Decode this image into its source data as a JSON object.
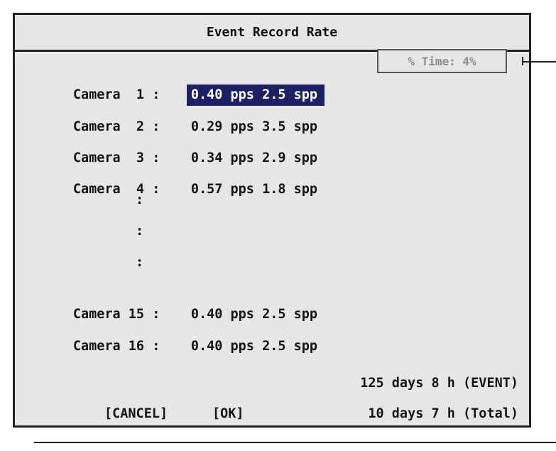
{
  "dialog": {
    "title": "Event Record Rate"
  },
  "cameras": [
    {
      "label": "Camera  1 :",
      "value": "0.40 pps 2.5 spp",
      "selected": true
    },
    {
      "label": "Camera  2 :",
      "value": "0.29 pps 3.5 spp"
    },
    {
      "label": "Camera  3 :",
      "value": "0.34 pps 2.9 spp"
    },
    {
      "label": "Camera  4 :",
      "value": "0.57 pps 1.8 spp"
    },
    {
      "label": "Camera 15 :",
      "value": "0.40 pps 2.5 spp"
    },
    {
      "label": "Camera 16 :",
      "value": "0.40 pps 2.5 spp"
    }
  ],
  "ellipsis": [
    ":",
    ":",
    ":"
  ],
  "time_box": {
    "label": "% Time: 4%"
  },
  "summary": {
    "event": "125 days 8 h (EVENT)",
    "total": "10 days 7 h (Total)"
  },
  "buttons": {
    "cancel": "[CANCEL]",
    "ok": "[OK]"
  },
  "colors": {
    "panel_bg": "#e6e6e6",
    "selection_bg": "#1e2161",
    "border": "#222222",
    "disabled_text": "#8c8c8c"
  }
}
